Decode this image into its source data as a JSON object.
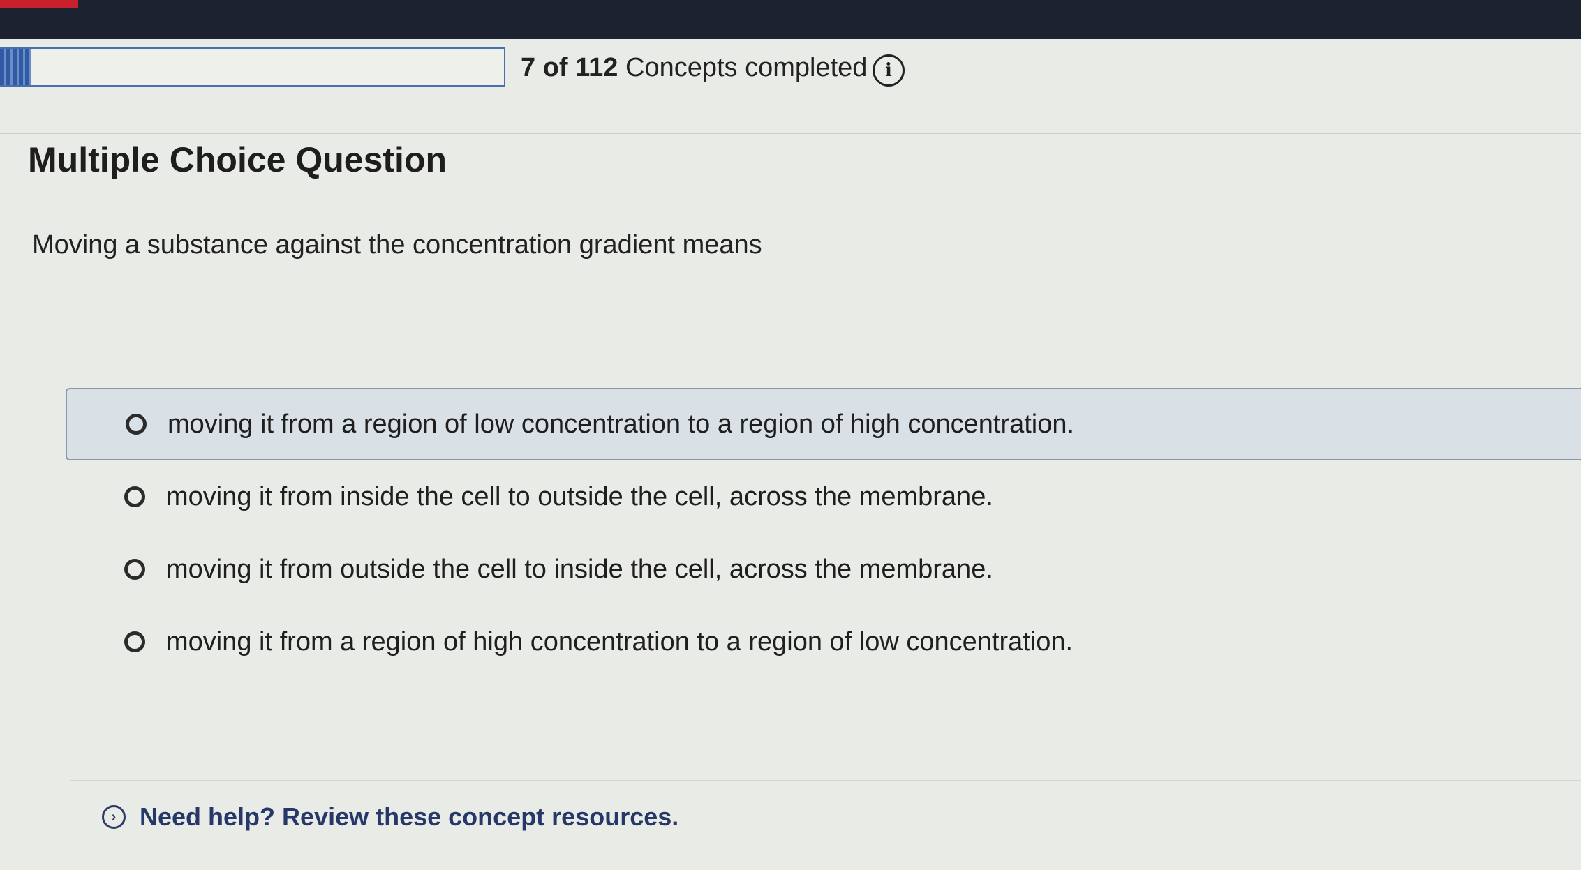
{
  "progress": {
    "completed": "7",
    "of_label": "of",
    "total": "112",
    "suffix": "Concepts completed",
    "fraction": 0.0625,
    "info_icon": "info-icon"
  },
  "question": {
    "type_label": "Multiple Choice Question",
    "stem": "Moving a substance against the concentration gradient means",
    "choices": [
      {
        "label": "moving it from a region of low concentration to a region of high concentration."
      },
      {
        "label": "moving it from inside the cell to outside the cell, across the membrane."
      },
      {
        "label": "moving it from outside the cell to inside the cell, across the membrane."
      },
      {
        "label": "moving it from a region of high concentration to a region of low concentration."
      }
    ]
  },
  "help": {
    "icon": "chevron-right-circle-icon",
    "label": "Need help? Review these concept resources."
  },
  "colors": {
    "top_bar": "#1d2230",
    "accent_blue": "#2e5aa6",
    "link_blue": "#26386a",
    "highlight_row": "#d9e1e6"
  }
}
